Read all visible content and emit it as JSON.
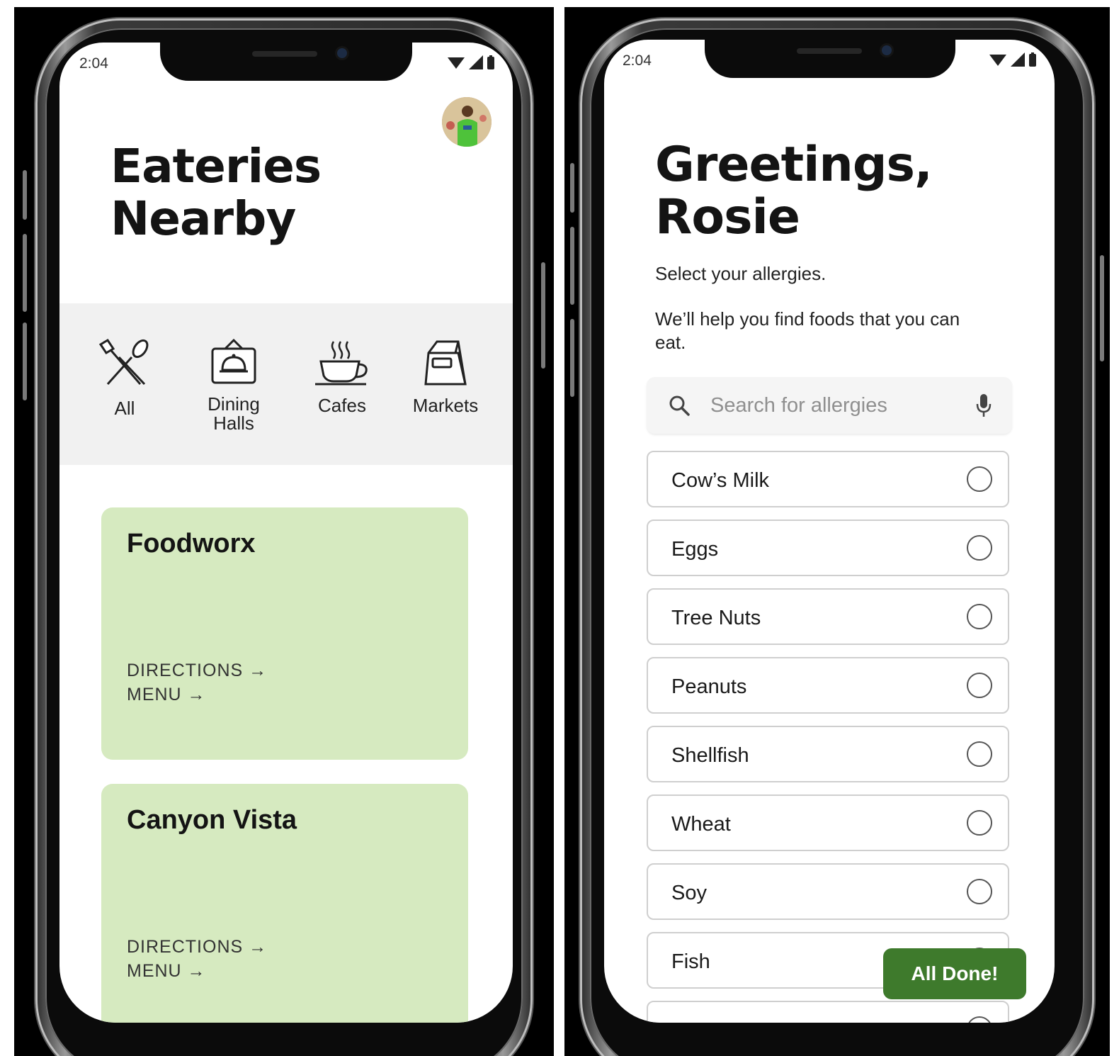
{
  "colors": {
    "card_green": "#d6eac0",
    "button_green": "#3e7a2c",
    "category_bg": "#f1f1f1"
  },
  "left_screen": {
    "status": {
      "time": "2:04"
    },
    "avatar_icon": "user-avatar",
    "title_line1": "Eateries",
    "title_line2": "Nearby",
    "categories": [
      {
        "label": "All",
        "icon": "fork-spoon-icon"
      },
      {
        "label_line1": "Dining",
        "label_line2": "Halls",
        "icon": "cloche-icon",
        "selected": true
      },
      {
        "label": "Cafes",
        "icon": "coffee-cup-icon"
      },
      {
        "label": "Markets",
        "icon": "shopping-bag-icon"
      }
    ],
    "eateries": [
      {
        "name": "Foodworx",
        "directions": "DIRECTIONS →",
        "menu": "MENU →"
      },
      {
        "name": "Canyon Vista",
        "directions": "DIRECTIONS →",
        "menu": "MENU →"
      }
    ]
  },
  "right_screen": {
    "status": {
      "time": "2:04"
    },
    "title_line1": "Greetings,",
    "title_line2": "Rosie",
    "instruction": "Select your allergies.",
    "help_text": "We’ll help you find foods that you can eat.",
    "search": {
      "placeholder": "Search for allergies",
      "icon": "search-icon",
      "mic_icon": "microphone-icon"
    },
    "allergies": [
      {
        "label": "Cow’s Milk",
        "selected": false
      },
      {
        "label": "Eggs",
        "selected": false
      },
      {
        "label": "Tree Nuts",
        "selected": false
      },
      {
        "label": "Peanuts",
        "selected": false
      },
      {
        "label": "Shellfish",
        "selected": false
      },
      {
        "label": "Wheat",
        "selected": false
      },
      {
        "label": "Soy",
        "selected": false
      },
      {
        "label": "Fish",
        "selected": false
      }
    ],
    "done_button": "All Done!"
  }
}
